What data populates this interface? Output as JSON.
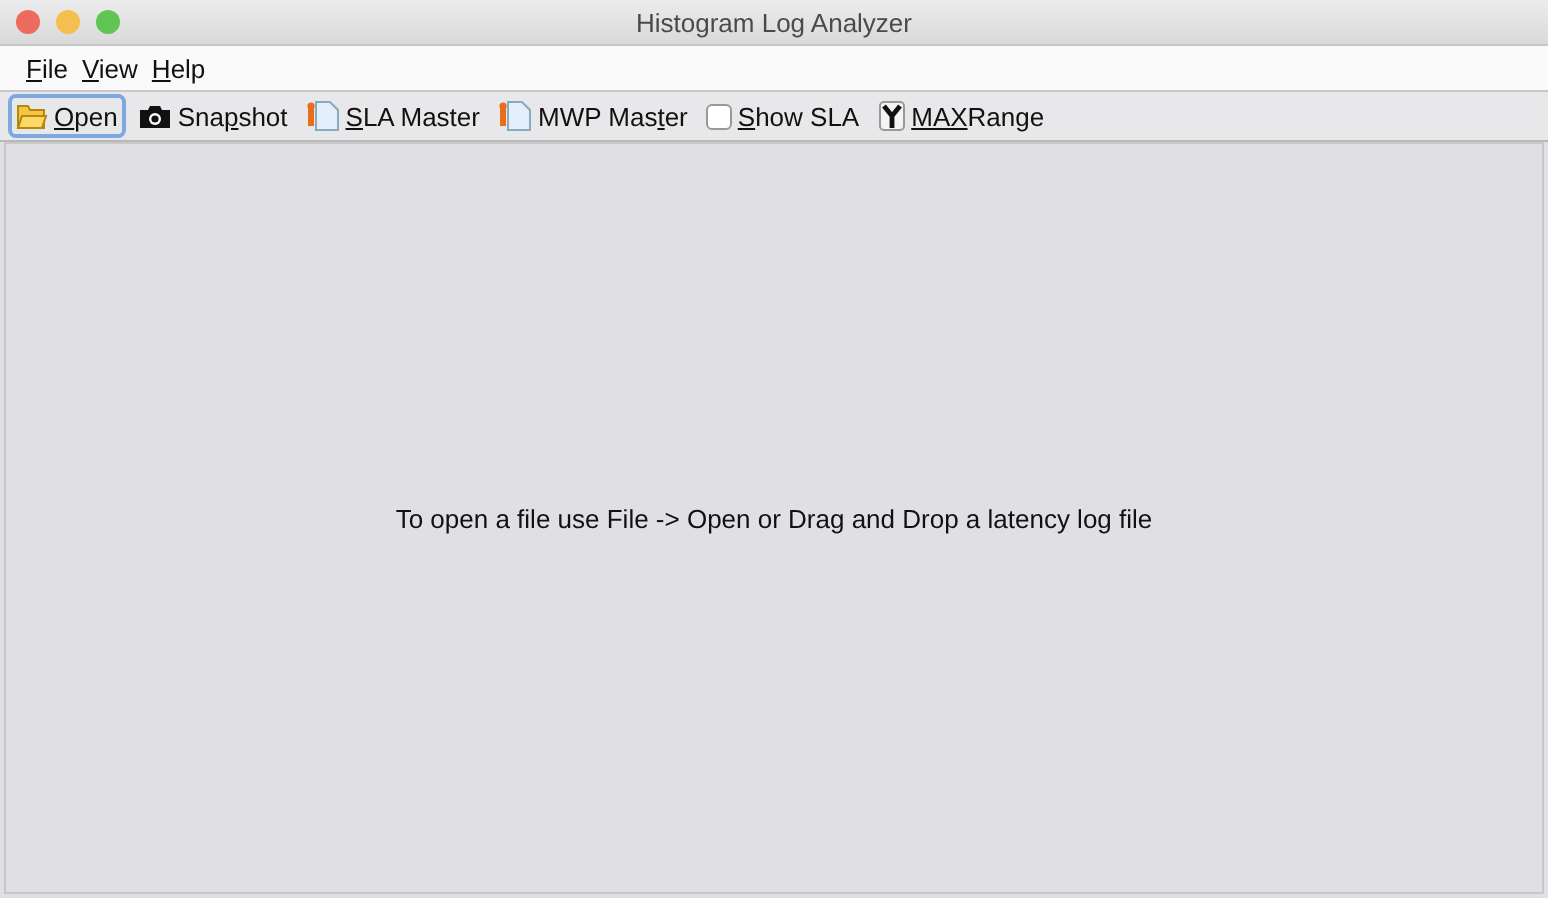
{
  "window": {
    "title": "Histogram Log Analyzer"
  },
  "menu": [
    {
      "key": "F",
      "after": "ile"
    },
    {
      "key": "V",
      "after": "iew"
    },
    {
      "key": "H",
      "after": "elp"
    }
  ],
  "toolbar": [
    {
      "kind": "button",
      "key": "O",
      "after": "pen",
      "focused": true
    },
    {
      "kind": "button",
      "before": "Sna",
      "key": "p",
      "after": "shot",
      "focused": false
    },
    {
      "kind": "button",
      "key": "S",
      "after": "LA Master",
      "focused": false
    },
    {
      "kind": "button",
      "before": "MWP Mas",
      "key": "t",
      "after": "er",
      "focused": false
    },
    {
      "kind": "checkbox",
      "key": "S",
      "after": "how SLA",
      "checked": false
    },
    {
      "kind": "button",
      "key": "MAX",
      "after": "Range",
      "focused": false
    }
  ],
  "message": "To open a file use File -> Open or Drag and Drop a latency log file"
}
